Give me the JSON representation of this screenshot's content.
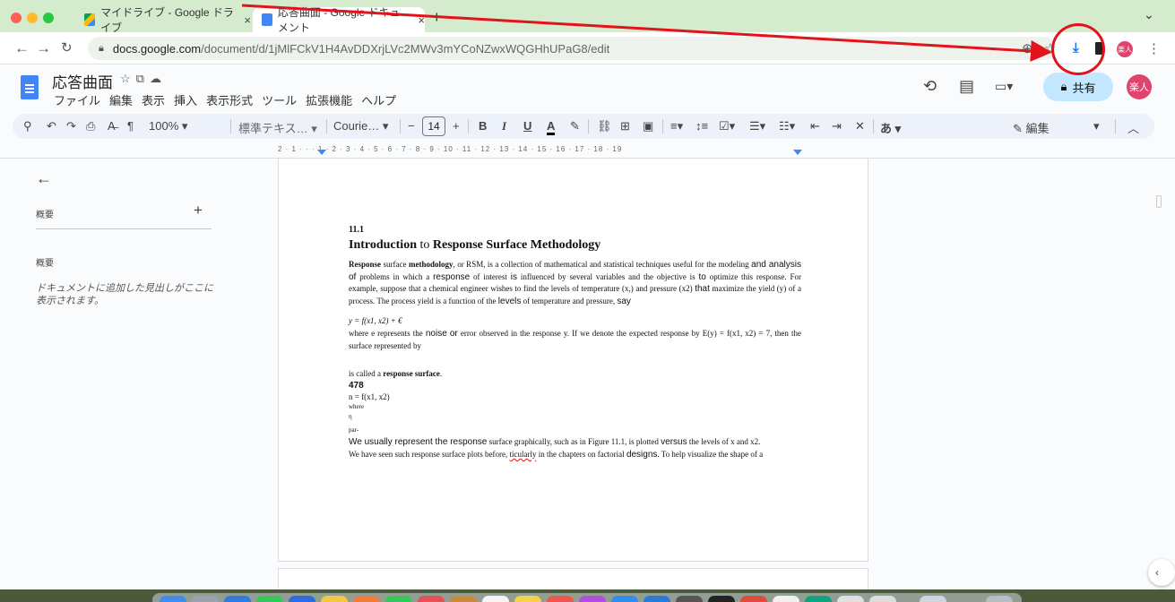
{
  "browser": {
    "tabs": [
      {
        "label": "マイドライブ - Google ドライブ",
        "close": "×"
      },
      {
        "label": "応答曲面 - Google ドキュメント",
        "close": "×"
      }
    ],
    "new_tab": "+",
    "tab_menu": "⌄",
    "url_host": "docs.google.com",
    "url_path": "/document/d/1jMlFCkV1H4AvDDXrjLVc2MWv3mYCoNZwxWQGHhUPaG8/edit",
    "profile": "楽人"
  },
  "docs": {
    "title": "応答曲面",
    "menu": [
      "ファイル",
      "編集",
      "表示",
      "挿入",
      "表示形式",
      "ツール",
      "拡張機能",
      "ヘルプ"
    ],
    "share_label": "共有",
    "avatar": "楽人"
  },
  "toolbar": {
    "zoom": "100%",
    "style": "標準テキス…",
    "font": "Courie…",
    "font_size": "14",
    "bold": "B",
    "italic": "I",
    "underline": "U",
    "text_color": "A",
    "input_tool": "あ",
    "mode": "編集"
  },
  "ruler": {
    "numbers": "2 · 1 · · · 1 · 2 · 3 · 4 · 5 · 6 · 7 · 8 · 9 · 10 · 11 · 12 · 13 · 14 · 15 · 16 · 17 · 18 · 19"
  },
  "outline": {
    "heading": "概要",
    "add": "+",
    "sub_heading": "概要",
    "hint": "ドキュメントに追加した見出しがここに表示されます。"
  },
  "document": {
    "section": "11.1",
    "heading_a": "Introduction",
    "heading_b": " to ",
    "heading_c": "Response Surface Methodology",
    "p1_a": "Response",
    "p1_b": " surface ",
    "p1_c": "methodology",
    "p1_d": ", or RSM, is a collection of mathematical and statistical techniques useful for the modeling ",
    "p1_e": "and analysis of",
    "p1_f": " problems in which a ",
    "p1_g": "response",
    "p1_h": " of interest ",
    "p1_i": "is",
    "p1_j": " influenced by several variables and the objective is ",
    "p1_k": "to",
    "p1_l": " optimize this response. For example, suppose that a chemical engineer wishes to find the levels of temperature (x,) and pressure (x2) ",
    "p1_m": "that",
    "p1_n": " maximize the yield (y) of a process. The process yield is a function of the ",
    "p1_o": "levels",
    "p1_p": " of temperature and pressure, ",
    "p1_q": "say",
    "eq1": "y = f(x1, x2) + €",
    "p2_a": "where e represents the ",
    "p2_b": "noise",
    "p2_c": " ",
    "p2_d": "or",
    "p2_e": " error observed in the response y. If we denote the expected response by E(y) = f(x1, x2) = 7, then the surface represented by",
    "p3_a": "is called a ",
    "p3_b": "response surface",
    "p3_c": ".",
    "num": "478",
    "eq2": "n = f(x1, x2)",
    "where": "where",
    "eta": "η",
    "par": "par-",
    "p4_a": "We usually represent the ",
    "p4_b": "response",
    "p4_c": " surface graphically, such as in Figure 11.1, is plotted ",
    "p4_d": "versus",
    "p4_e": " the levels of x and x2.",
    "p5_a": "We have seen such response surface plots before, ",
    "p5_b": "ticularly",
    "p5_c": " in the chapters on factorial ",
    "p5_d": "designs",
    "p5_e": ". To help visualize the shape of a"
  },
  "colors": {
    "tabbar": "#d4eccd",
    "share_bg": "#c2e7ff",
    "accent": "#4285f4",
    "annotation": "#e3131b",
    "avatar": "#e0436d"
  }
}
